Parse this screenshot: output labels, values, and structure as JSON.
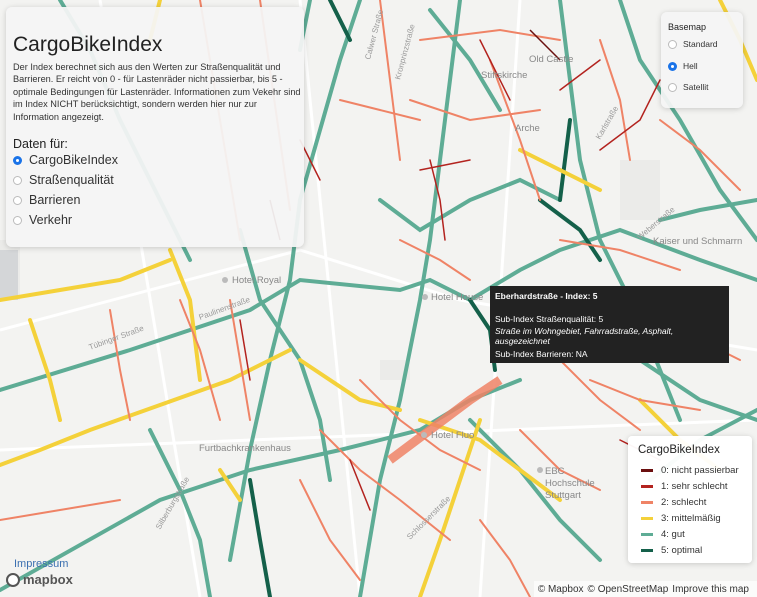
{
  "info_panel": {
    "title": "CargoBikeIndex",
    "description": "Der Index berechnet sich aus den Werten zur Straßenqualität und Barrieren. Er reicht von 0 - für Lastenräder nicht passierbar, bis 5 - optimale Bedingungen für Lastenräder. Informationen zum Vekehr sind im Index NICHT berücksichtigt, sondern werden hier nur zur Information angezeigt.",
    "daten_label": "Daten für:",
    "options": [
      "CargoBikeIndex",
      "Straßenqualität",
      "Barrieren",
      "Verkehr"
    ],
    "selected": "CargoBikeIndex"
  },
  "basemap": {
    "title": "Basemap",
    "options": [
      "Standard",
      "Hell",
      "Satellit"
    ],
    "selected": "Hell"
  },
  "legend": {
    "title": "CargoBikeIndex",
    "items": [
      {
        "label": "0: nicht passierbar",
        "color": "#6b0f0f"
      },
      {
        "label": "1: sehr schlecht",
        "color": "#b3231f"
      },
      {
        "label": "2: schlecht",
        "color": "#ef8366"
      },
      {
        "label": "3: mittelmäßig",
        "color": "#f4d13a"
      },
      {
        "label": "4: gut",
        "color": "#5eac95"
      },
      {
        "label": "5: optimal",
        "color": "#14604a"
      }
    ]
  },
  "tooltip": {
    "line1": "Eberhardstraße - Index: 5",
    "line2": "Sub-Index Straßenqualität: 5",
    "line3": "Straße im Wohngebiet, Fahrradstraße, Asphalt, ausgezeichnet",
    "line4": "Sub-Index Barrieren: NA"
  },
  "map_labels": {
    "old_castle": "Old Castle",
    "stiftskirche": "Stiftskirche",
    "arche": "Arche",
    "kaiser": "Kaiser und Schmarrn",
    "hotel_royal": "Hotel Royal",
    "hotel_house": "Hotel House",
    "furtbach": "Furtbachkrankenhaus",
    "hotel_fluo": "Hotel Fluo",
    "ebc": "EBC Hochschule Stuttgart"
  },
  "footer": {
    "impressum": "Impressum",
    "mapbox": "mapbox",
    "attribution": [
      "© Mapbox",
      "© OpenStreetMap",
      "Improve this map"
    ]
  }
}
